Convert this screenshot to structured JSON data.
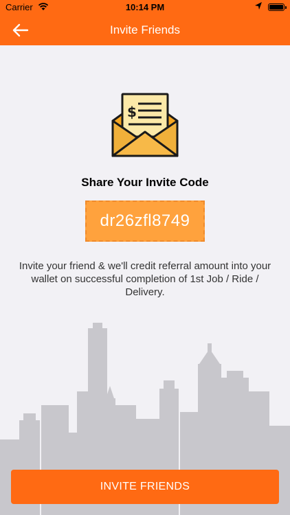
{
  "status_bar": {
    "carrier": "Carrier",
    "time": "10:14 PM"
  },
  "nav": {
    "title": "Invite Friends",
    "back_icon": "arrow-left-icon"
  },
  "colors": {
    "accent": "#ff6a13",
    "code_bg": "#ffa23d",
    "background": "#f2f1f5"
  },
  "content": {
    "illustration": "money-envelope-icon",
    "share_title": "Share Your Invite Code",
    "invite_code": "dr26zfl8749",
    "description": "Invite your friend & we'll credit referral amount into your wallet on successful completion of 1st Job / Ride / Delivery."
  },
  "footer": {
    "invite_button_label": "INVITE FRIENDS"
  }
}
